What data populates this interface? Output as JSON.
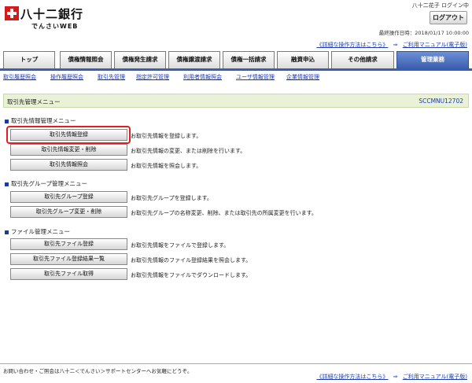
{
  "header": {
    "bank_name": "八十二銀行",
    "bank_sub": "でんさいWEB",
    "user_status": "八十二花子 ログイン中",
    "logout_label": "ログアウト",
    "last_operation": "最終操作日時：2018/01/17 10:00:00"
  },
  "help": {
    "method_link": "《詳細な操作方法はこちら》",
    "arrow": "⇒",
    "manual_link": "ご利用マニュアル(電子版)"
  },
  "nav": {
    "tabs": [
      {
        "label": "トップ"
      },
      {
        "label": "債権情報照会"
      },
      {
        "label": "債権発生請求"
      },
      {
        "label": "債権譲渡請求"
      },
      {
        "label": "債権一括請求"
      },
      {
        "label": "融資申込"
      },
      {
        "label": "その他請求"
      },
      {
        "label": "管理業務"
      }
    ],
    "sub": [
      {
        "label": "取引履歴照会"
      },
      {
        "label": "操作履歴照会"
      },
      {
        "label": "取引先管理"
      },
      {
        "label": "指定許可管理"
      },
      {
        "label": "利用者情報照会"
      },
      {
        "label": "ユーザ情報管理"
      },
      {
        "label": "企業情報管理"
      }
    ]
  },
  "page": {
    "title": "取引先管理メニュー",
    "code": "SCCMNU12702"
  },
  "sections": [
    {
      "title": "取引先情報管理メニュー",
      "items": [
        {
          "button": "取引先情報登録",
          "desc": "お取引先情報を登録します。"
        },
        {
          "button": "取引先情報変更・削除",
          "desc": "お取引先情報の変更、または削除を行います。"
        },
        {
          "button": "取引先情報照会",
          "desc": "お取引先情報を照会します。"
        }
      ]
    },
    {
      "title": "取引先グループ管理メニュー",
      "items": [
        {
          "button": "取引先グループ登録",
          "desc": "お取引先グループを登録します。"
        },
        {
          "button": "取引先グループ変更・削除",
          "desc": "お取引先グループの名称変更、削除、または取引先の所属変更を行います。"
        }
      ]
    },
    {
      "title": "ファイル管理メニュー",
      "items": [
        {
          "button": "取引先ファイル登録",
          "desc": "お取引先情報をファイルで登録します。"
        },
        {
          "button": "取引先ファイル登録結果一覧",
          "desc": "お取引先情報のファイル登録結果を照会します。"
        },
        {
          "button": "取引先ファイル取得",
          "desc": "お取引先情報をファイルでダウンロードします。"
        }
      ]
    }
  ],
  "footer": {
    "contact": "お問い合わせ・ご照会は八十二＜でんさい＞サポートセンターへお気軽にどうぞ。"
  },
  "colors": {
    "accent": "#3a5fae",
    "highlight": "#e02020",
    "title_bg": "#e9f1d6"
  }
}
